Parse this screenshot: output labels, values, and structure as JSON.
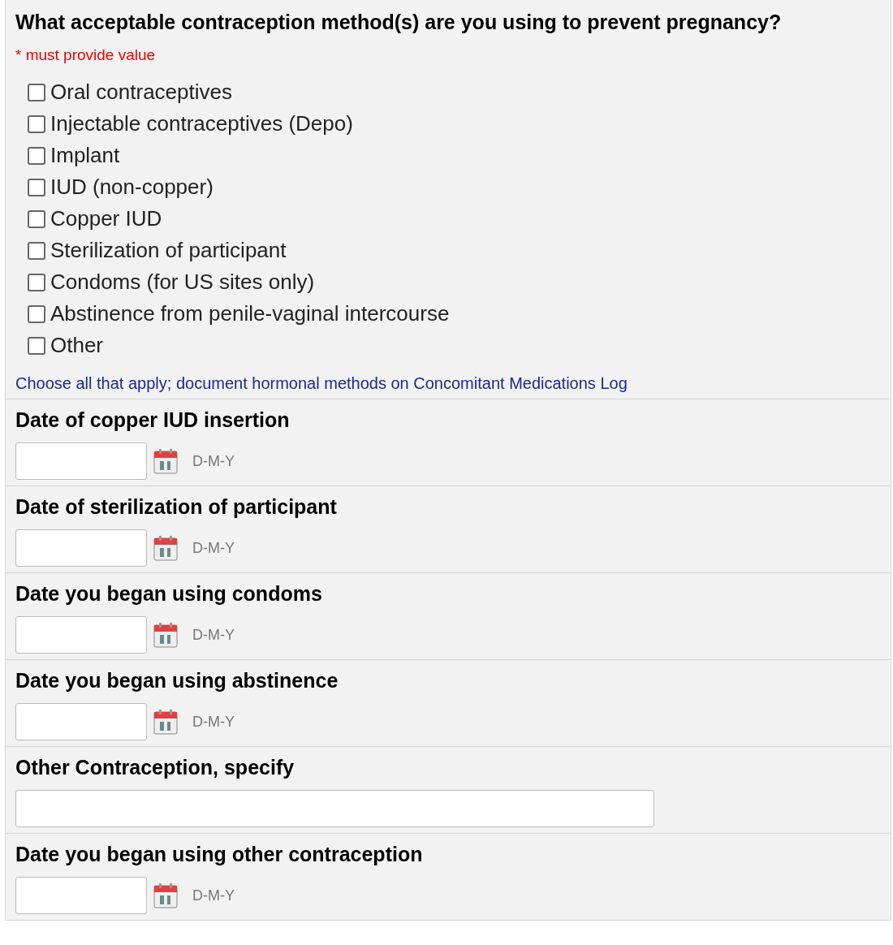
{
  "question": {
    "title": "What acceptable contraception method(s) are you using to prevent pregnancy?",
    "required_note": "* must provide value",
    "options": [
      {
        "label": "Oral contraceptives",
        "checked": false
      },
      {
        "label": "Injectable contraceptives (Depo)",
        "checked": false
      },
      {
        "label": "Implant",
        "checked": false
      },
      {
        "label": "IUD (non-copper)",
        "checked": false
      },
      {
        "label": "Copper IUD",
        "checked": false
      },
      {
        "label": "Sterilization of participant",
        "checked": false
      },
      {
        "label": "Condoms (for US sites only)",
        "checked": false
      },
      {
        "label": "Abstinence from penile-vaginal intercourse",
        "checked": false
      },
      {
        "label": "Other",
        "checked": false
      }
    ],
    "hint": "Choose all that apply; document hormonal methods on Concomitant Medications Log"
  },
  "fields": [
    {
      "kind": "date",
      "label": "Date of copper IUD insertion",
      "format": "D-M-Y"
    },
    {
      "kind": "date",
      "label": "Date of sterilization of participant",
      "format": "D-M-Y"
    },
    {
      "kind": "date",
      "label": "Date you began using condoms",
      "format": "D-M-Y"
    },
    {
      "kind": "date",
      "label": "Date you began using abstinence",
      "format": "D-M-Y"
    },
    {
      "kind": "text",
      "label": "Other Contraception, specify"
    },
    {
      "kind": "date",
      "label": "Date you began using other contraception",
      "format": "D-M-Y"
    }
  ]
}
